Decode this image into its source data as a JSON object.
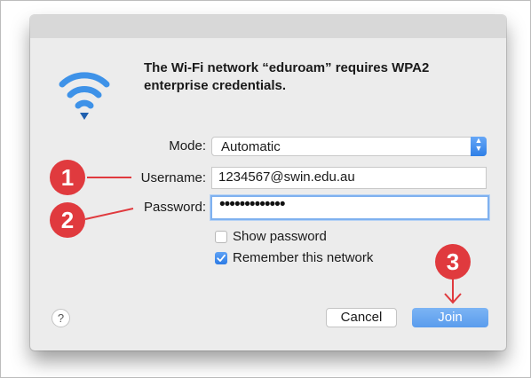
{
  "dialog": {
    "message": "The Wi-Fi network “eduroam” requires WPA2 enterprise credentials.",
    "mode": {
      "label": "Mode:",
      "value": "Automatic"
    },
    "username": {
      "label": "Username:",
      "value": "1234567@swin.edu.au"
    },
    "password": {
      "label": "Password:",
      "masked_value": "•••••••••••••"
    },
    "show_password": {
      "label": "Show password",
      "checked": false
    },
    "remember_network": {
      "label": "Remember this network",
      "checked": true
    },
    "help_label": "?",
    "cancel_label": "Cancel",
    "join_label": "Join"
  },
  "callouts": [
    {
      "number": "1",
      "target": "username"
    },
    {
      "number": "2",
      "target": "password"
    },
    {
      "number": "3",
      "target": "join"
    }
  ],
  "colors": {
    "accent": "#2f7fe6",
    "callout": "#e03a3e"
  }
}
